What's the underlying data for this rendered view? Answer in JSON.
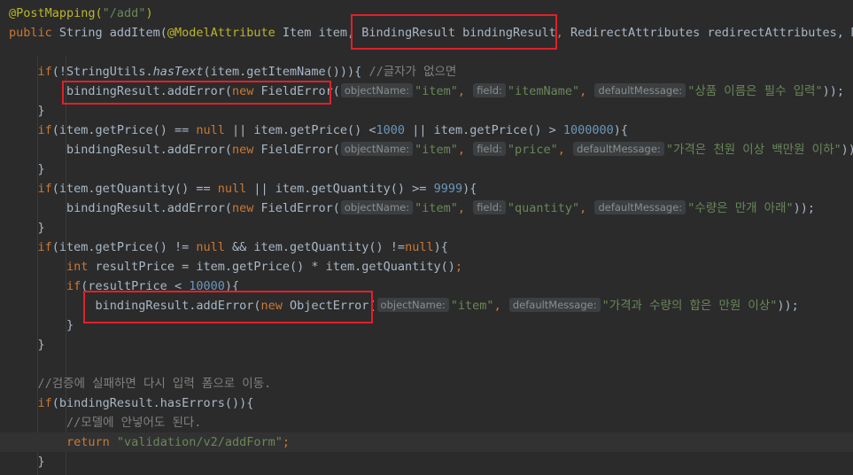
{
  "editor": {
    "lines": [
      [
        {
          "t": "@PostMapping(",
          "c": "ann"
        },
        {
          "t": "\"/add\"",
          "c": "str"
        },
        {
          "t": ")",
          "c": "ann"
        }
      ],
      [
        {
          "t": "public ",
          "c": "kw"
        },
        {
          "t": "String addItem(",
          "c": "var"
        },
        {
          "t": "@ModelAttribute",
          "c": "ann"
        },
        {
          "t": " Item item, ",
          "c": "var"
        },
        {
          "t": "BindingResult bindingResult",
          "c": "var"
        },
        {
          "t": ", ",
          "c": "kw"
        },
        {
          "t": "RedirectAttributes redirectAttributes, Mo",
          "c": "var"
        }
      ],
      [],
      [
        {
          "t": "    if",
          "c": "kw"
        },
        {
          "t": "(!StringUtils.",
          "c": "var"
        },
        {
          "t": "hasText",
          "c": "var it"
        },
        {
          "t": "(item.getItemName()))",
          "c": "var"
        },
        {
          "t": "{ ",
          "c": "var"
        },
        {
          "t": "//글자가 없으면",
          "c": "cmt"
        }
      ],
      [
        {
          "t": "        bindingResult.addError(",
          "c": "var"
        },
        {
          "t": "new ",
          "c": "kw"
        },
        {
          "t": "FieldError(",
          "c": "var"
        },
        {
          "h": "objectName:"
        },
        {
          "t": "\"item\"",
          "c": "str"
        },
        {
          "t": ", ",
          "c": "kw"
        },
        {
          "h": "field:"
        },
        {
          "t": "\"itemName\"",
          "c": "str"
        },
        {
          "t": ", ",
          "c": "kw"
        },
        {
          "h": "defaultMessage:"
        },
        {
          "t": "\"상품 이름은 필수 입력\"",
          "c": "str"
        },
        {
          "t": "));",
          "c": "var"
        }
      ],
      [
        {
          "t": "    }",
          "c": "var"
        }
      ],
      [
        {
          "t": "    if",
          "c": "kw"
        },
        {
          "t": "(item.getPrice() == ",
          "c": "var"
        },
        {
          "t": "null",
          "c": "kw"
        },
        {
          "t": " || item.getPrice() <",
          "c": "var"
        },
        {
          "t": "1000",
          "c": "num"
        },
        {
          "t": " || item.getPrice() > ",
          "c": "var"
        },
        {
          "t": "1000000",
          "c": "num"
        },
        {
          "t": "){",
          "c": "var"
        }
      ],
      [
        {
          "t": "        bindingResult.addError(",
          "c": "var"
        },
        {
          "t": "new ",
          "c": "kw"
        },
        {
          "t": "FieldError(",
          "c": "var"
        },
        {
          "h": "objectName:"
        },
        {
          "t": "\"item\"",
          "c": "str"
        },
        {
          "t": ", ",
          "c": "kw"
        },
        {
          "h": "field:"
        },
        {
          "t": "\"price\"",
          "c": "str"
        },
        {
          "t": ", ",
          "c": "kw"
        },
        {
          "h": "defaultMessage:"
        },
        {
          "t": "\"가격은 천원 이상 백만원 이하\"",
          "c": "str"
        },
        {
          "t": "));",
          "c": "var"
        }
      ],
      [
        {
          "t": "    }",
          "c": "var"
        }
      ],
      [
        {
          "t": "    if",
          "c": "kw"
        },
        {
          "t": "(item.getQuantity() == ",
          "c": "var"
        },
        {
          "t": "null",
          "c": "kw"
        },
        {
          "t": " || item.getQuantity() >= ",
          "c": "var"
        },
        {
          "t": "9999",
          "c": "num"
        },
        {
          "t": "){",
          "c": "var"
        }
      ],
      [
        {
          "t": "        bindingResult.addError(",
          "c": "var"
        },
        {
          "t": "new ",
          "c": "kw"
        },
        {
          "t": "FieldError(",
          "c": "var"
        },
        {
          "h": "objectName:"
        },
        {
          "t": "\"item\"",
          "c": "str"
        },
        {
          "t": ", ",
          "c": "kw"
        },
        {
          "h": "field:"
        },
        {
          "t": "\"quantity\"",
          "c": "str"
        },
        {
          "t": ", ",
          "c": "kw"
        },
        {
          "h": "defaultMessage:"
        },
        {
          "t": "\"수량은 만개 아래\"",
          "c": "str"
        },
        {
          "t": "));",
          "c": "var"
        }
      ],
      [
        {
          "t": "    }",
          "c": "var"
        }
      ],
      [
        {
          "t": "    if",
          "c": "kw"
        },
        {
          "t": "(item.getPrice() != ",
          "c": "var"
        },
        {
          "t": "null",
          "c": "kw"
        },
        {
          "t": " && item.getQuantity() !=",
          "c": "var"
        },
        {
          "t": "null",
          "c": "kw"
        },
        {
          "t": "){",
          "c": "var"
        }
      ],
      [
        {
          "t": "        int ",
          "c": "kw"
        },
        {
          "t": "resultPrice = item.getPrice() * item.getQuantity()",
          "c": "var"
        },
        {
          "t": ";",
          "c": "kw"
        }
      ],
      [
        {
          "t": "        if",
          "c": "kw"
        },
        {
          "t": "(resultPrice < ",
          "c": "var"
        },
        {
          "t": "10000",
          "c": "num"
        },
        {
          "t": "){",
          "c": "var"
        }
      ],
      [
        {
          "t": "            bindingResult.addError(",
          "c": "var"
        },
        {
          "t": "new ",
          "c": "kw"
        },
        {
          "t": "ObjectError(",
          "c": "var"
        },
        {
          "h": "objectName:"
        },
        {
          "t": "\"item\"",
          "c": "str"
        },
        {
          "t": ", ",
          "c": "kw"
        },
        {
          "h": "defaultMessage:"
        },
        {
          "t": "\"가격과 수량의 합은 만원 이상\"",
          "c": "str"
        },
        {
          "t": "));",
          "c": "var"
        }
      ],
      [
        {
          "t": "        }",
          "c": "var"
        }
      ],
      [
        {
          "t": "    }",
          "c": "var"
        }
      ],
      [],
      [
        {
          "t": "    //검증에 실패하면 다시 입력 폼으로 이동.",
          "c": "cmt"
        }
      ],
      [
        {
          "t": "    if",
          "c": "kw"
        },
        {
          "t": "(bindingResult.hasErrors()){",
          "c": "var"
        }
      ],
      [
        {
          "t": "        //모델에 안넣어도 된다.",
          "c": "cmt"
        }
      ],
      [
        {
          "t": "        return ",
          "c": "kw"
        },
        {
          "t": "\"validation/v2/addForm\"",
          "c": "str"
        },
        {
          "t": ";",
          "c": "kw"
        }
      ],
      [
        {
          "t": "    }",
          "c": "var"
        }
      ]
    ]
  }
}
